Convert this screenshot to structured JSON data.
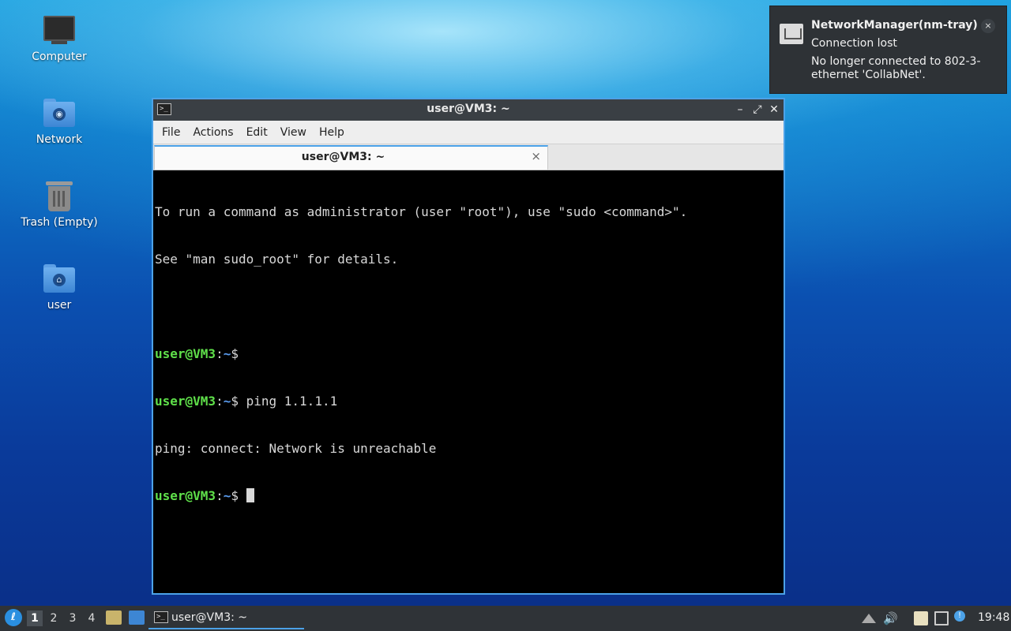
{
  "desktop": {
    "icons": [
      {
        "label": "Computer",
        "icon": "computer-icon"
      },
      {
        "label": "Network",
        "icon": "network-folder-icon"
      },
      {
        "label": "Trash (Empty)",
        "icon": "trash-icon"
      },
      {
        "label": "user",
        "icon": "home-folder-icon"
      }
    ]
  },
  "terminal": {
    "window_title": "user@VM3: ~",
    "menu": [
      "File",
      "Actions",
      "Edit",
      "View",
      "Help"
    ],
    "tab_label": "user@VM3: ~",
    "lines": {
      "l1": "To run a command as administrator (user \"root\"), use \"sudo <command>\".",
      "l2": "See \"man sudo_root\" for details.",
      "prompt_user": "user@VM3",
      "prompt_sep": ":",
      "prompt_path": "~",
      "prompt_dollar": "$",
      "cmd": " ping 1.1.1.1",
      "output": "ping: connect: Network is unreachable"
    }
  },
  "notification": {
    "app": "NetworkManager(nm-tray)",
    "summary": "Connection lost",
    "body": "No longer connected to 802-3-ethernet 'CollabNet'.",
    "close_symbol": "×"
  },
  "taskbar": {
    "workspaces": [
      "1",
      "2",
      "3",
      "4"
    ],
    "active_workspace": "1",
    "task_label": "user@VM3: ~",
    "clock": "19:48"
  },
  "colors": {
    "accent": "#4ca2e8",
    "prompt_user": "#5fe04a",
    "prompt_path": "#5a9cf0",
    "terminal_bg": "#000000",
    "panel_bg": "#2f3337"
  }
}
